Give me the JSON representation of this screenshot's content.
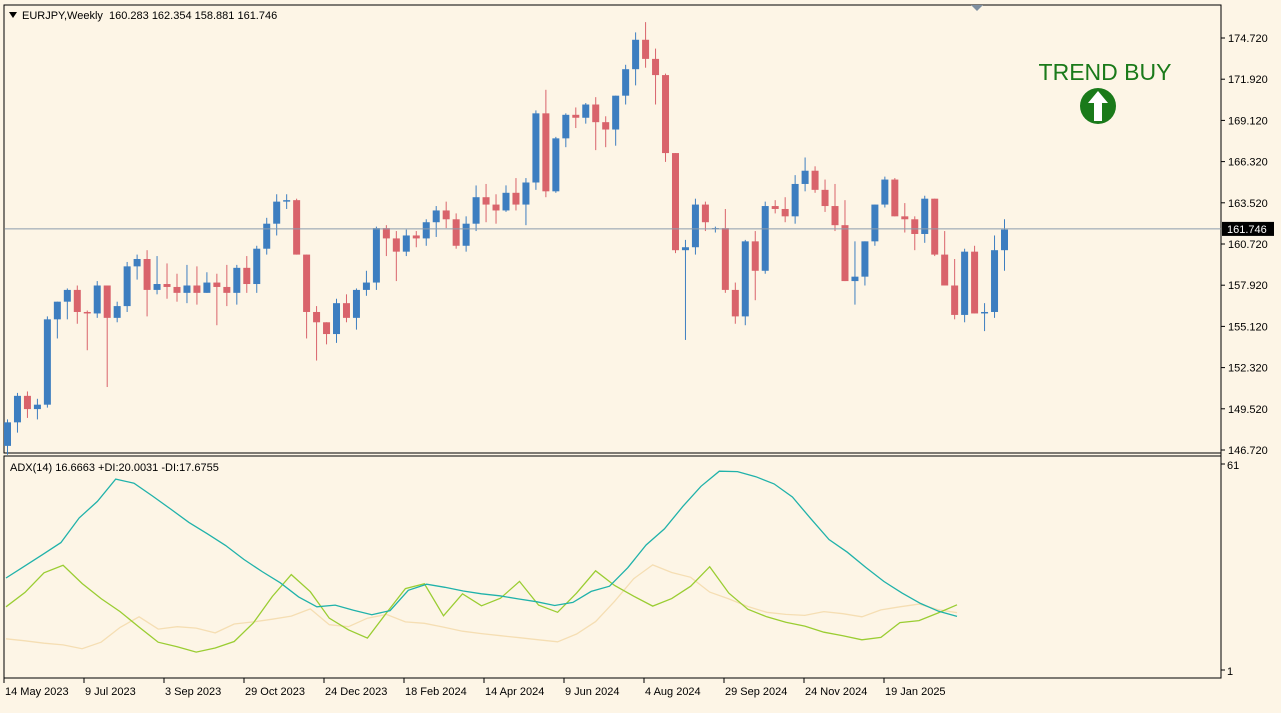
{
  "symbol_line": {
    "symbol": "EURJPY,Weekly",
    "ohlc": "160.283 162.354 158.881 161.746"
  },
  "indicator_line": "ADX(14) 16.6663 +DI:20.0031 -DI:17.6755",
  "signal": {
    "label": "TREND BUY",
    "icon": "up-arrow-circle-icon",
    "color": "#1a7a1a"
  },
  "price_scale": {
    "ticks": [
      "174.720",
      "171.920",
      "169.120",
      "166.320",
      "163.520",
      "160.720",
      "157.920",
      "155.120",
      "152.320",
      "149.520",
      "146.720"
    ],
    "current_price_label": "161.746"
  },
  "adx_scale": {
    "max_label": "61",
    "min_label": "1"
  },
  "time_scale": {
    "labels": [
      "14 May 2023",
      "9 Jul 2023",
      "3 Sep 2023",
      "29 Oct 2023",
      "24 Dec 2023",
      "18 Feb 2024",
      "14 Apr 2024",
      "9 Jun 2024",
      "4 Aug 2024",
      "29 Sep 2024",
      "24 Nov 2024",
      "19 Jan 2025"
    ]
  },
  "colors": {
    "background": "#fdf5e6",
    "bull_candle": "#3d7ec0",
    "bear_candle": "#d9636b",
    "adx_line": "#20b2aa",
    "plus_di_line": "#9acd32",
    "minus_di_line": "#f5deb3",
    "current_price_line": "#8c9cac"
  },
  "chart_data": [
    {
      "type": "candlestick",
      "title": "EURJPY,Weekly",
      "y_range": [
        146.0,
        176.0
      ],
      "current_price": 161.746,
      "candles": [
        [
          147.0,
          148.8,
          146.4,
          148.6
        ],
        [
          148.6,
          150.6,
          147.9,
          150.4
        ],
        [
          150.4,
          150.7,
          148.9,
          149.5
        ],
        [
          149.5,
          150.2,
          148.8,
          149.8
        ],
        [
          149.8,
          155.8,
          149.6,
          155.6
        ],
        [
          155.6,
          156.4,
          154.3,
          156.8
        ],
        [
          156.8,
          157.7,
          155.6,
          157.6
        ],
        [
          157.6,
          157.9,
          155.3,
          156.1
        ],
        [
          156.1,
          156.2,
          153.5,
          156.0
        ],
        [
          156.0,
          158.2,
          155.7,
          157.9
        ],
        [
          157.9,
          157.5,
          151.0,
          155.7
        ],
        [
          155.7,
          156.8,
          155.4,
          156.5
        ],
        [
          156.5,
          159.5,
          156.1,
          159.2
        ],
        [
          159.2,
          160.0,
          158.3,
          159.7
        ],
        [
          159.7,
          160.3,
          155.8,
          157.6
        ],
        [
          157.6,
          159.9,
          157.3,
          158.0
        ],
        [
          158.0,
          159.4,
          157.0,
          157.8
        ],
        [
          157.8,
          158.7,
          156.8,
          157.4
        ],
        [
          157.4,
          159.3,
          156.7,
          157.9
        ],
        [
          157.9,
          159.2,
          156.6,
          157.4
        ],
        [
          157.4,
          158.8,
          157.4,
          158.1
        ],
        [
          158.1,
          158.7,
          155.2,
          157.8
        ],
        [
          157.8,
          159.3,
          156.5,
          157.4
        ],
        [
          157.4,
          159.3,
          156.6,
          159.1
        ],
        [
          159.1,
          159.9,
          157.4,
          158.0
        ],
        [
          158.0,
          160.6,
          157.4,
          160.4
        ],
        [
          160.4,
          162.5,
          160.0,
          162.1
        ],
        [
          162.1,
          164.1,
          161.3,
          163.6
        ],
        [
          163.6,
          164.1,
          163.1,
          163.7
        ],
        [
          163.7,
          163.8,
          160.0,
          160.0
        ],
        [
          160.0,
          159.9,
          154.3,
          156.1
        ],
        [
          156.1,
          156.5,
          152.8,
          155.4
        ],
        [
          155.4,
          155.2,
          153.9,
          154.6
        ],
        [
          154.6,
          157.0,
          154.0,
          156.7
        ],
        [
          156.7,
          157.3,
          155.4,
          155.7
        ],
        [
          155.7,
          157.7,
          154.9,
          157.6
        ],
        [
          157.6,
          158.9,
          157.2,
          158.1
        ],
        [
          158.1,
          161.9,
          157.6,
          161.8
        ],
        [
          161.8,
          162.0,
          159.9,
          161.1
        ],
        [
          161.1,
          161.6,
          158.2,
          160.2
        ],
        [
          160.2,
          161.7,
          159.9,
          161.3
        ],
        [
          161.3,
          161.6,
          160.5,
          161.1
        ],
        [
          161.1,
          162.4,
          160.6,
          162.2
        ],
        [
          162.2,
          163.3,
          161.2,
          163.0
        ],
        [
          163.0,
          163.6,
          161.8,
          162.4
        ],
        [
          162.4,
          162.8,
          160.4,
          160.6
        ],
        [
          160.6,
          162.6,
          160.2,
          162.1
        ],
        [
          162.1,
          164.7,
          161.6,
          163.9
        ],
        [
          163.9,
          164.8,
          162.2,
          163.4
        ],
        [
          163.4,
          164.1,
          162.1,
          163.0
        ],
        [
          163.0,
          164.7,
          162.9,
          164.2
        ],
        [
          164.2,
          165.2,
          163.0,
          163.4
        ],
        [
          163.4,
          165.2,
          162.0,
          164.9
        ],
        [
          164.9,
          169.8,
          164.4,
          169.6
        ],
        [
          169.6,
          171.2,
          163.9,
          164.3
        ],
        [
          164.3,
          168.0,
          164.2,
          167.9
        ],
        [
          167.9,
          169.6,
          167.3,
          169.5
        ],
        [
          169.5,
          170.0,
          168.6,
          169.3
        ],
        [
          169.3,
          170.3,
          168.9,
          170.2
        ],
        [
          170.2,
          170.7,
          167.1,
          169.0
        ],
        [
          169.0,
          169.4,
          167.3,
          168.5
        ],
        [
          168.5,
          170.8,
          167.4,
          170.8
        ],
        [
          170.8,
          172.9,
          170.2,
          172.6
        ],
        [
          172.6,
          175.1,
          171.5,
          174.6
        ],
        [
          174.6,
          175.8,
          172.7,
          173.3
        ],
        [
          173.3,
          174.0,
          170.2,
          172.2
        ],
        [
          172.2,
          172.3,
          166.3,
          166.9
        ],
        [
          166.9,
          166.1,
          160.1,
          160.3
        ],
        [
          160.3,
          161.0,
          154.2,
          160.5
        ],
        [
          160.5,
          163.8,
          160.0,
          163.4
        ],
        [
          163.4,
          163.6,
          161.6,
          162.2
        ],
        [
          161.8,
          161.9,
          161.5,
          161.8
        ],
        [
          161.8,
          163.1,
          157.4,
          157.6
        ],
        [
          157.6,
          158.1,
          155.3,
          155.8
        ],
        [
          155.8,
          161.0,
          155.2,
          160.9
        ],
        [
          160.9,
          161.6,
          156.9,
          158.9
        ],
        [
          158.9,
          163.6,
          158.7,
          163.3
        ],
        [
          163.3,
          163.7,
          162.8,
          163.1
        ],
        [
          163.1,
          163.9,
          162.2,
          162.6
        ],
        [
          162.6,
          165.4,
          162.1,
          164.8
        ],
        [
          164.8,
          166.6,
          164.3,
          165.7
        ],
        [
          165.7,
          166.0,
          164.2,
          164.4
        ],
        [
          164.4,
          165.1,
          162.9,
          163.3
        ],
        [
          163.3,
          164.8,
          161.6,
          162.0
        ],
        [
          162.0,
          163.7,
          159.4,
          158.2
        ],
        [
          158.2,
          160.9,
          156.6,
          158.5
        ],
        [
          158.5,
          160.9,
          157.9,
          160.9
        ],
        [
          160.9,
          163.4,
          160.6,
          163.4
        ],
        [
          163.4,
          165.3,
          163.2,
          165.1
        ],
        [
          165.1,
          165.2,
          162.8,
          162.6
        ],
        [
          162.6,
          163.5,
          161.5,
          162.4
        ],
        [
          162.4,
          162.6,
          160.3,
          161.4
        ],
        [
          161.4,
          164.0,
          160.8,
          163.8
        ],
        [
          163.8,
          163.8,
          159.9,
          160.0
        ],
        [
          160.0,
          161.6,
          157.9,
          157.9
        ],
        [
          157.9,
          159.7,
          155.6,
          155.9
        ],
        [
          155.9,
          160.4,
          155.4,
          160.2
        ],
        [
          160.2,
          160.6,
          156.6,
          156.0
        ],
        [
          156.0,
          156.7,
          154.8,
          156.1
        ],
        [
          156.1,
          161.3,
          155.7,
          160.3
        ],
        [
          160.3,
          162.4,
          158.9,
          161.7
        ]
      ]
    },
    {
      "type": "line",
      "title": "ADX(14)",
      "y_range": [
        1,
        61
      ],
      "series": [
        {
          "name": "ADX(14)",
          "values": [
            27.8,
            31.2,
            34.6,
            38.1,
            45.3,
            50.1,
            56.6,
            55.4,
            51.7,
            47.9,
            44.0,
            40.7,
            37.3,
            33.2,
            29.7,
            26.4,
            22.3,
            19.4,
            19.9,
            18.4,
            17.1,
            18.3,
            24.2,
            26.0,
            25.1,
            24.0,
            23.2,
            22.6,
            21.7,
            20.9,
            19.8,
            20.7,
            23.9,
            25.4,
            30.8,
            37.4,
            42.1,
            48.6,
            54.5,
            58.9,
            58.8,
            57.3,
            55.2,
            51.4,
            45.1,
            39.0,
            35.3,
            30.9,
            26.8,
            23.4,
            20.4,
            18.1,
            16.6
          ]
        },
        {
          "name": "+DI",
          "values": [
            19.4,
            23.6,
            29.3,
            31.5,
            26.2,
            21.8,
            18.0,
            13.5,
            9.1,
            7.8,
            6.2,
            7.4,
            9.3,
            14.7,
            22.4,
            28.8,
            23.8,
            16.1,
            12.7,
            10.3,
            17.6,
            24.7,
            26.1,
            16.8,
            23.2,
            19.7,
            21.9,
            26.8,
            19.9,
            17.8,
            23.4,
            29.9,
            25.6,
            22.5,
            19.6,
            21.8,
            25.4,
            31.1,
            23.4,
            18.7,
            16.5,
            14.9,
            13.8,
            12.0,
            11.0,
            9.8,
            10.5,
            14.8,
            15.4,
            17.6,
            20.0
          ]
        },
        {
          "name": "-DI",
          "values": [
            10.1,
            9.5,
            8.8,
            8.3,
            7.2,
            9.1,
            13.4,
            16.5,
            12.9,
            13.6,
            13.2,
            11.8,
            14.4,
            15.0,
            15.8,
            16.7,
            18.8,
            14.2,
            13.6,
            16.1,
            17.2,
            15.0,
            14.6,
            13.5,
            12.3,
            11.6,
            11.0,
            10.4,
            9.8,
            9.2,
            11.5,
            15.1,
            21.0,
            27.6,
            31.6,
            29.4,
            28.0,
            23.7,
            21.7,
            19.5,
            17.8,
            17.2,
            16.9,
            18.0,
            17.4,
            16.5,
            18.5,
            19.4,
            20.2,
            18.6,
            17.7
          ]
        }
      ]
    }
  ]
}
